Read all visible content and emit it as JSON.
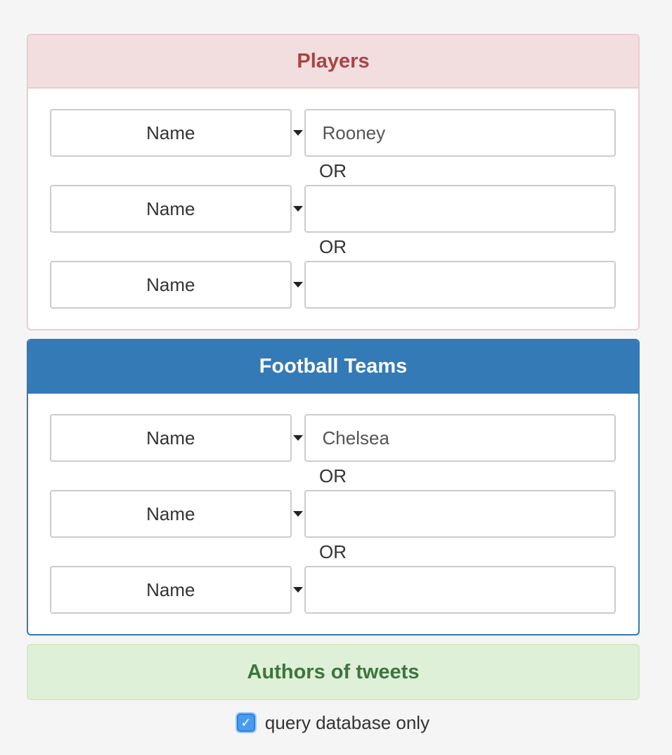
{
  "panels": {
    "players": {
      "title": "Players",
      "rows": [
        {
          "field": "Name",
          "value": ""
        },
        {
          "field": "Name",
          "value": ""
        },
        {
          "field": "Name",
          "value": ""
        }
      ],
      "first_value": "Rooney",
      "separator": "OR"
    },
    "teams": {
      "title": "Football Teams",
      "rows": [
        {
          "field": "Name",
          "value": ""
        },
        {
          "field": "Name",
          "value": ""
        },
        {
          "field": "Name",
          "value": ""
        }
      ],
      "first_value": "Chelsea",
      "separator": "OR"
    },
    "authors": {
      "title": "Authors of tweets"
    }
  },
  "options": {
    "query_db_only_label": "query database only",
    "query_db_only_checked": true
  },
  "colors": {
    "danger_bg": "#f2dede",
    "danger_text": "#a94442",
    "primary": "#337ab7",
    "success_bg": "#dff0d8",
    "success_text": "#3c763d",
    "checkbox": "#4a9bf0"
  },
  "icons": {
    "dropdown": "caret-down-icon",
    "check": "check-icon"
  }
}
